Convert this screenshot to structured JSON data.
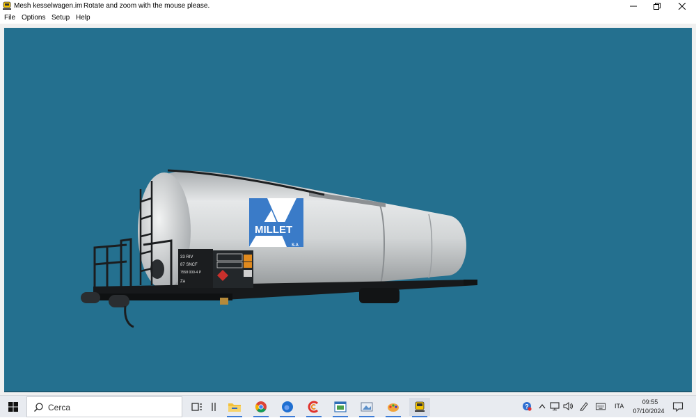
{
  "window": {
    "title": "Mesh kesselwagen.im",
    "hint": "Rotate and zoom with the mouse please.",
    "controls": [
      "minimize",
      "restore",
      "close"
    ]
  },
  "menu": {
    "file": "File",
    "options": "Options",
    "setup": "Setup",
    "help": "Help"
  },
  "scene": {
    "background": "#24708f",
    "model": "tank-wagon-3d",
    "tank_color": "#d4d7d8",
    "livery": {
      "logo_text": "MILLET",
      "logo_suffix": "S.A",
      "logo_color": "#3a7bc8"
    },
    "plate": {
      "lines": [
        "33 RIV",
        "87 SNCF",
        "7558 000-4 P",
        "Za"
      ]
    }
  },
  "taskbar": {
    "search_placeholder": "Cerca",
    "apps": [
      "task-view",
      "pinned-divider",
      "file-explorer",
      "chrome",
      "firefox",
      "app-ccleaner",
      "app-window",
      "app-viewer",
      "app-paint",
      "app-train"
    ],
    "tray": {
      "language": "ITA",
      "time": "09:55",
      "date": "07/10/2024"
    }
  }
}
